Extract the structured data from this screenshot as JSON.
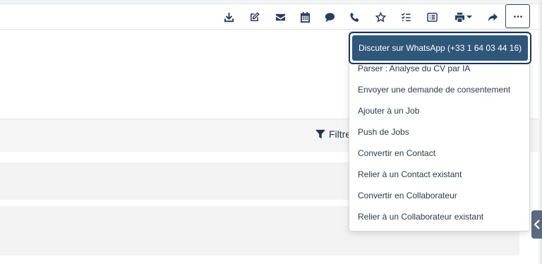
{
  "colors": {
    "toolbar_icon": "#243f5e",
    "highlight_bg": "#2f5779",
    "highlight_border": "#1d3557",
    "panel_gray": "#f3f3f3"
  },
  "toolbar": {
    "icons": [
      "download-icon",
      "edit-icon",
      "envelope-icon",
      "calendar-icon",
      "chat-icon",
      "phone-icon",
      "star-icon",
      "checklist-icon",
      "list-icon",
      "print-icon",
      "share-icon",
      "ellipsis-icon"
    ]
  },
  "filter": {
    "label": "Filtre"
  },
  "menu": {
    "items": [
      {
        "label": "Discuter sur WhatsApp (+33 1 64 03 44 16)",
        "active": true
      },
      {
        "label": "Parser : Analyse du CV par IA"
      },
      {
        "label": "Envoyer une demande de consentement"
      },
      {
        "label": "Ajouter à un Job"
      },
      {
        "label": "Push de Jobs"
      },
      {
        "label": "Convertir en Contact"
      },
      {
        "label": "Relier à un Contact existant"
      },
      {
        "label": "Convertir en Collaborateur"
      },
      {
        "label": "Relier à un Collaborateur existant"
      }
    ]
  }
}
